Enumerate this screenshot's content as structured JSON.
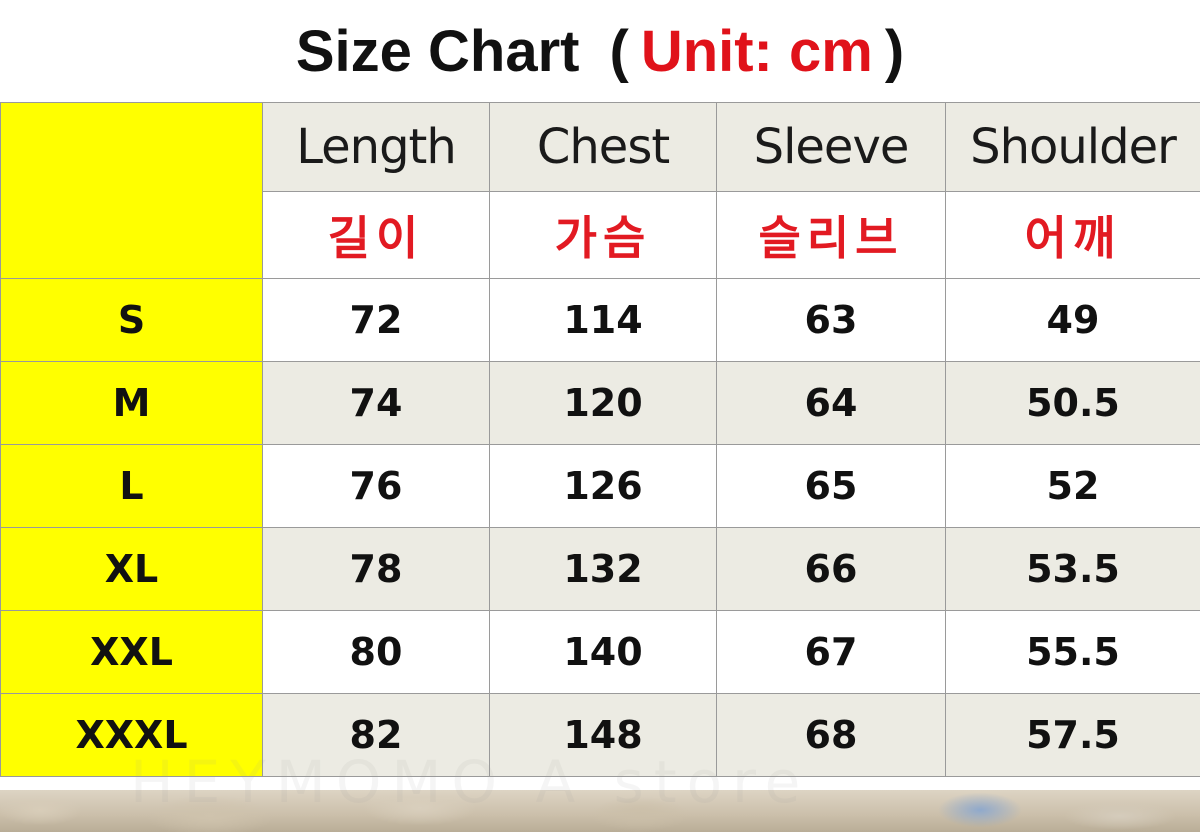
{
  "title": {
    "main": "Size Chart",
    "open_paren": "(",
    "unit": "Unit: cm",
    "close_paren": ")"
  },
  "watermark": "HEYMOMO A  store",
  "columns": [
    {
      "en": "Length",
      "ko": "길이"
    },
    {
      "en": "Chest",
      "ko": "가슴"
    },
    {
      "en": "Sleeve",
      "ko": "슬리브"
    },
    {
      "en": "Shoulder",
      "ko": "어깨"
    }
  ],
  "rows": [
    {
      "size": "S",
      "values": [
        "72",
        "114",
        "63",
        "49"
      ]
    },
    {
      "size": "M",
      "values": [
        "74",
        "120",
        "64",
        "50.5"
      ]
    },
    {
      "size": "L",
      "values": [
        "76",
        "126",
        "65",
        "52"
      ]
    },
    {
      "size": "XL",
      "values": [
        "78",
        "132",
        "66",
        "53.5"
      ]
    },
    {
      "size": "XXL",
      "values": [
        "80",
        "140",
        "67",
        "55.5"
      ]
    },
    {
      "size": "XXXL",
      "values": [
        "82",
        "148",
        "68",
        "57.5"
      ]
    }
  ],
  "colors": {
    "title_text": "#111111",
    "unit_text": "#e0121a",
    "size_column_bg": "#ffff00",
    "header_bg": "#ecebe3",
    "korean_text": "#e21a22",
    "row_alt_bg": "#ecebe3",
    "border": "#9a9a9a"
  }
}
